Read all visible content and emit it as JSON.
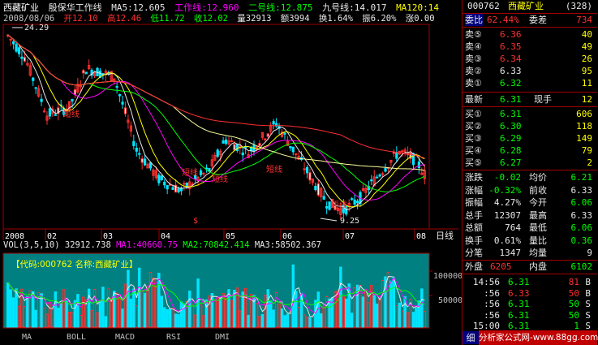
{
  "header": {
    "stock_name": "西藏矿业",
    "indicator_name": "殷保华工作线",
    "ma5": "MA5:12.605",
    "work_line": "工作线:12.960",
    "line2": "二号线:12.875",
    "line9": "九号线:14.017",
    "ma120": "MA120:14",
    "date": "2008/08/06",
    "open": "开12.10",
    "high": "高12.46",
    "low": "低11.72",
    "close": "收12.02",
    "volume": "量32913",
    "amount": "额3994",
    "turnover": "换1.64%",
    "amplitude": "振6.20%",
    "change": "涨0.00"
  },
  "price_chart": {
    "axis_label_high": "24.29",
    "axis_label_low": "9.25",
    "annotations": [
      "短线",
      "短线",
      "短线",
      "短线",
      "短线"
    ],
    "buy_signal": "$",
    "months": [
      "2008",
      "02",
      "03",
      "04",
      "05",
      "06",
      "07",
      "08"
    ],
    "period_label": "日线"
  },
  "volume_chart": {
    "title": "VOL(3,5,10)",
    "vol": "32912.738",
    "ma1": "MA1:40660.75",
    "ma2": "MA2:70842.414",
    "ma3": "MA3:58502.367",
    "code_banner": "【代码:000762 名称:西藏矿业】",
    "y_labels": [
      "100000",
      "50000"
    ]
  },
  "tabs": [
    "MA",
    "BOLL",
    "MACD",
    "RSI",
    "DMI"
  ],
  "quote": {
    "code": "000762",
    "name": "西藏矿业",
    "board": "(328)",
    "weibi_label": "委比",
    "weibi_value": "62.44%",
    "weicha_label": "委差",
    "weicha_value": "734",
    "asks": [
      {
        "label": "卖⑤",
        "price": "6.36",
        "vol": "40"
      },
      {
        "label": "卖④",
        "price": "6.35",
        "vol": "49"
      },
      {
        "label": "卖③",
        "price": "6.34",
        "vol": "26"
      },
      {
        "label": "卖②",
        "price": "6.33",
        "vol": "95"
      },
      {
        "label": "卖①",
        "price": "6.32",
        "vol": "11"
      }
    ],
    "last_label": "最新",
    "last_price": "6.31",
    "cur_hand_label": "现手",
    "cur_hand": "12",
    "bids": [
      {
        "label": "买①",
        "price": "6.31",
        "vol": "606"
      },
      {
        "label": "买②",
        "price": "6.30",
        "vol": "118"
      },
      {
        "label": "买③",
        "price": "6.29",
        "vol": "149"
      },
      {
        "label": "买④",
        "price": "6.28",
        "vol": "79"
      },
      {
        "label": "买⑤",
        "price": "6.27",
        "vol": "2"
      }
    ],
    "stats": [
      {
        "l": "涨跌",
        "v": "-0.02",
        "l2": "均价",
        "v2": "6.21"
      },
      {
        "l": "涨幅",
        "v": "-0.32%",
        "l2": "前收",
        "v2": "6.33"
      },
      {
        "l": "振幅",
        "v": "4.27%",
        "l2": "今开",
        "v2": "6.06"
      },
      {
        "l": "总手",
        "v": "12307",
        "l2": "最高",
        "v2": "6.33"
      },
      {
        "l": "总额",
        "v": "764",
        "l2": "最低",
        "v2": "6.06"
      },
      {
        "l": "换手",
        "v": "0.61%",
        "l2": "量比",
        "v2": "0.36"
      },
      {
        "l": "分笔",
        "v": "1347",
        "l2": "均量",
        "v2": "9"
      }
    ],
    "outer_label": "外盘",
    "outer": "6205",
    "inner_label": "内盘",
    "inner": "6102",
    "ticks": [
      {
        "time": "14:56",
        "price": "6.31",
        "vol": "81",
        "side": "B"
      },
      {
        "time": ":56",
        "price": "6.33",
        "vol": "50",
        "side": "B"
      },
      {
        "time": ":56",
        "price": "6.31",
        "vol": "50",
        "side": "S"
      },
      {
        "time": ":56",
        "price": "6.31",
        "vol": "50",
        "side": "S"
      },
      {
        "time": "15:00",
        "price": "6.31",
        "vol": "1",
        "side": "S"
      }
    ],
    "side_tab": "细",
    "footer_brand": "分析家公式网",
    "footer_url": "www.88gg.com"
  }
}
